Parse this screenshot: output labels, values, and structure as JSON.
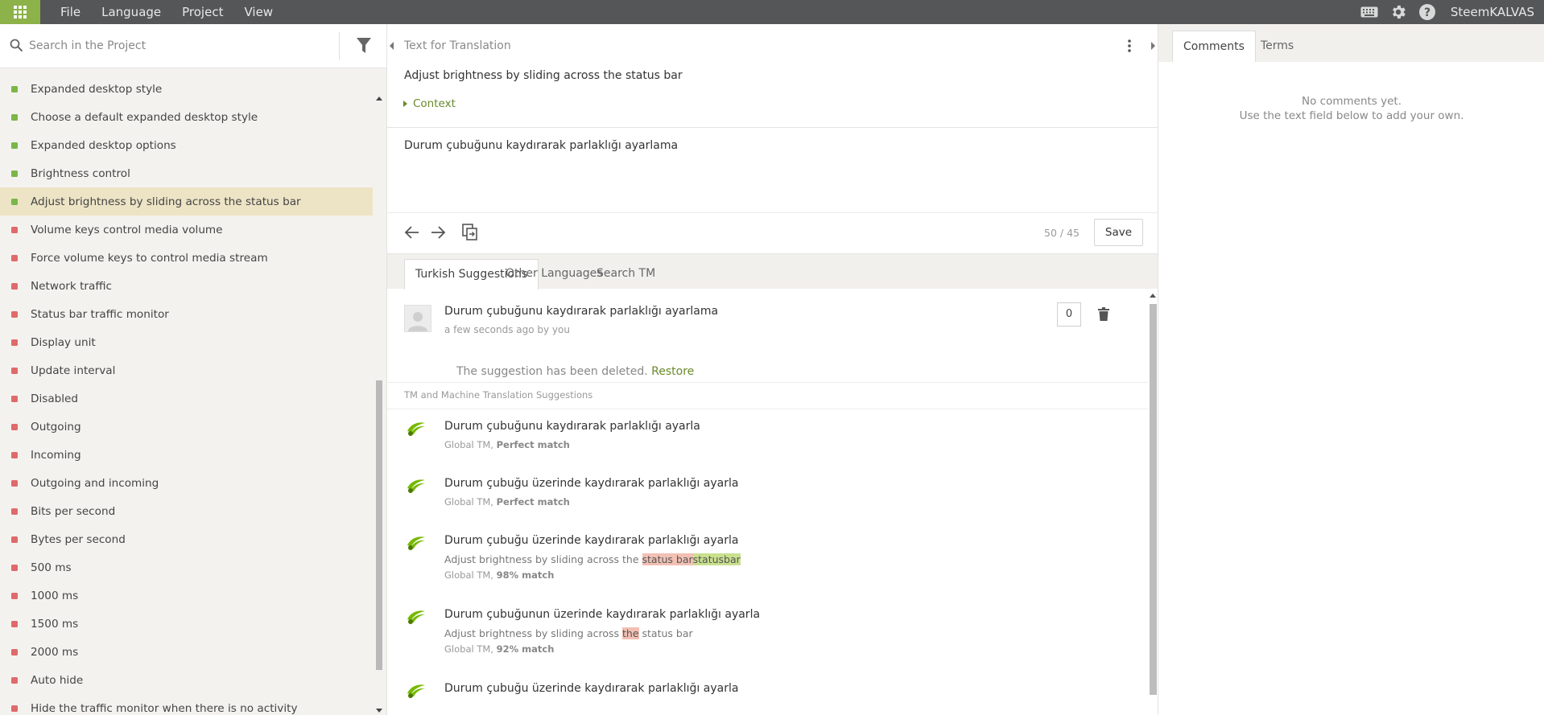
{
  "topbar": {
    "menu": [
      "File",
      "Language",
      "Project",
      "View"
    ],
    "user": "SteemKALVAS"
  },
  "left": {
    "search_placeholder": "Search in the Project",
    "items": [
      {
        "label": "Expanded desktop style",
        "status": "translated"
      },
      {
        "label": "Choose a default expanded desktop style",
        "status": "translated"
      },
      {
        "label": "Expanded desktop options",
        "status": "translated"
      },
      {
        "label": "Brightness control",
        "status": "translated"
      },
      {
        "label": "Adjust brightness by sliding across the status bar",
        "status": "translated",
        "active": true
      },
      {
        "label": "Volume keys control media volume",
        "status": "untranslated"
      },
      {
        "label": "Force volume keys to control media stream",
        "status": "untranslated"
      },
      {
        "label": "Network traffic",
        "status": "untranslated"
      },
      {
        "label": "Status bar traffic monitor",
        "status": "untranslated"
      },
      {
        "label": "Display unit",
        "status": "untranslated"
      },
      {
        "label": "Update interval",
        "status": "untranslated"
      },
      {
        "label": "Disabled",
        "status": "untranslated"
      },
      {
        "label": "Outgoing",
        "status": "untranslated"
      },
      {
        "label": "Incoming",
        "status": "untranslated"
      },
      {
        "label": "Outgoing and incoming",
        "status": "untranslated"
      },
      {
        "label": "Bits per second",
        "status": "untranslated"
      },
      {
        "label": "Bytes per second",
        "status": "untranslated"
      },
      {
        "label": "500 ms",
        "status": "untranslated"
      },
      {
        "label": "1000 ms",
        "status": "untranslated"
      },
      {
        "label": "1500 ms",
        "status": "untranslated"
      },
      {
        "label": "2000 ms",
        "status": "untranslated"
      },
      {
        "label": "Auto hide",
        "status": "untranslated"
      },
      {
        "label": "Hide the traffic monitor when there is no activity",
        "status": "untranslated"
      }
    ]
  },
  "editor": {
    "header": "Text for Translation",
    "source": "Adjust brightness by sliding across the status bar",
    "context_label": "Context",
    "translation": "Durum çubuğunu kaydırarak parlaklığı ayarlama",
    "counter": "50 / 45",
    "save_label": "Save"
  },
  "tabs": [
    "Turkish Suggestions",
    "Other Languages",
    "Search TM"
  ],
  "own_suggestion": {
    "text": "Durum çubuğunu kaydırarak parlaklığı ayarlama",
    "meta": "a few seconds ago by you",
    "votes": "0",
    "deleted_msg": "The suggestion has been deleted.",
    "restore": "Restore"
  },
  "tm_header": "TM and Machine Translation Suggestions",
  "tm": [
    {
      "text": "Durum çubuğunu kaydırarak parlaklığı ayarla",
      "source_label": "Global TM,",
      "match": "Perfect match"
    },
    {
      "text": "Durum çubuğu üzerinde kaydırarak parlaklığı ayarla",
      "source_label": "Global TM,",
      "match": "Perfect match"
    },
    {
      "text": "Durum çubuğu üzerinde kaydırarak parlaklığı ayarla",
      "diff_prefix": "Adjust brightness by sliding across the ",
      "diff_del": "status bar",
      "diff_ins": "statusbar",
      "diff_suffix": "",
      "source_label": "Global TM,",
      "match": "98% match"
    },
    {
      "text": "Durum çubuğunun üzerinde kaydırarak parlaklığı ayarla",
      "diff_prefix": "Adjust brightness by sliding across ",
      "diff_del": "the",
      "diff_ins": "",
      "diff_suffix": " status bar",
      "source_label": "Global TM,",
      "match": "92% match"
    },
    {
      "text": "Durum çubuğu üzerinde kaydırarak parlaklığı ayarla"
    }
  ],
  "right": {
    "tabs": [
      "Comments",
      "Terms"
    ],
    "empty_line1": "No comments yet.",
    "empty_line2": "Use the text field below to add your own."
  },
  "colors": {
    "brand": "#8cb249",
    "topbar": "#555657",
    "translated": "#7ab648",
    "untranslated": "#e06969",
    "active_row": "#ede4c6"
  }
}
